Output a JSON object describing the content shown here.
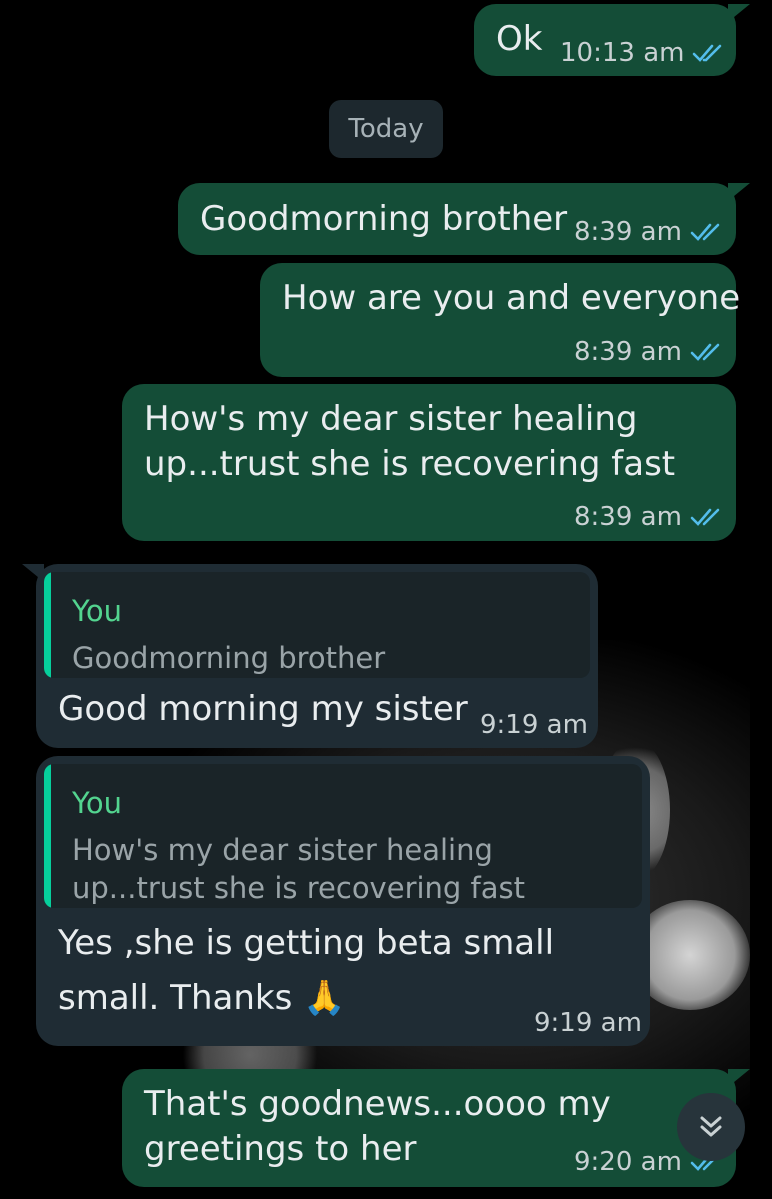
{
  "colors": {
    "outgoing_bubble": "#144d37",
    "incoming_bubble": "#1f2c34",
    "read_tick": "#53bdeb",
    "quote_name": "#53d48f",
    "background": "#000000"
  },
  "date_divider": "Today",
  "messages": [
    {
      "direction": "out",
      "text": "Ok",
      "time": "10:13 am",
      "status": "read"
    },
    {
      "direction": "out",
      "text": "Goodmorning brother",
      "time": "8:39 am",
      "status": "read"
    },
    {
      "direction": "out",
      "text": "How are you and everyone",
      "time": "8:39 am",
      "status": "read"
    },
    {
      "direction": "out",
      "lines": [
        "How's my dear sister healing",
        "up...trust she is recovering fast"
      ],
      "time": "8:39 am",
      "status": "read"
    },
    {
      "direction": "in",
      "quote": {
        "author": "You",
        "text": "Goodmorning brother"
      },
      "text": "Good morning my sister",
      "time": "9:19 am"
    },
    {
      "direction": "in",
      "quote": {
        "author": "You",
        "lines": [
          "How's my dear sister healing",
          "up...trust she is recovering fast"
        ]
      },
      "lines": [
        "Yes ,she is getting beta small",
        "small. Thanks 🙏"
      ],
      "time": "9:19 am"
    },
    {
      "direction": "out",
      "lines": [
        "That's goodnews...oooo my",
        "greetings to her"
      ],
      "time": "9:20 am",
      "status": "read"
    }
  ],
  "icons": {
    "read_receipt": "double-check-icon",
    "scroll_down": "double-chevron-down-icon"
  }
}
